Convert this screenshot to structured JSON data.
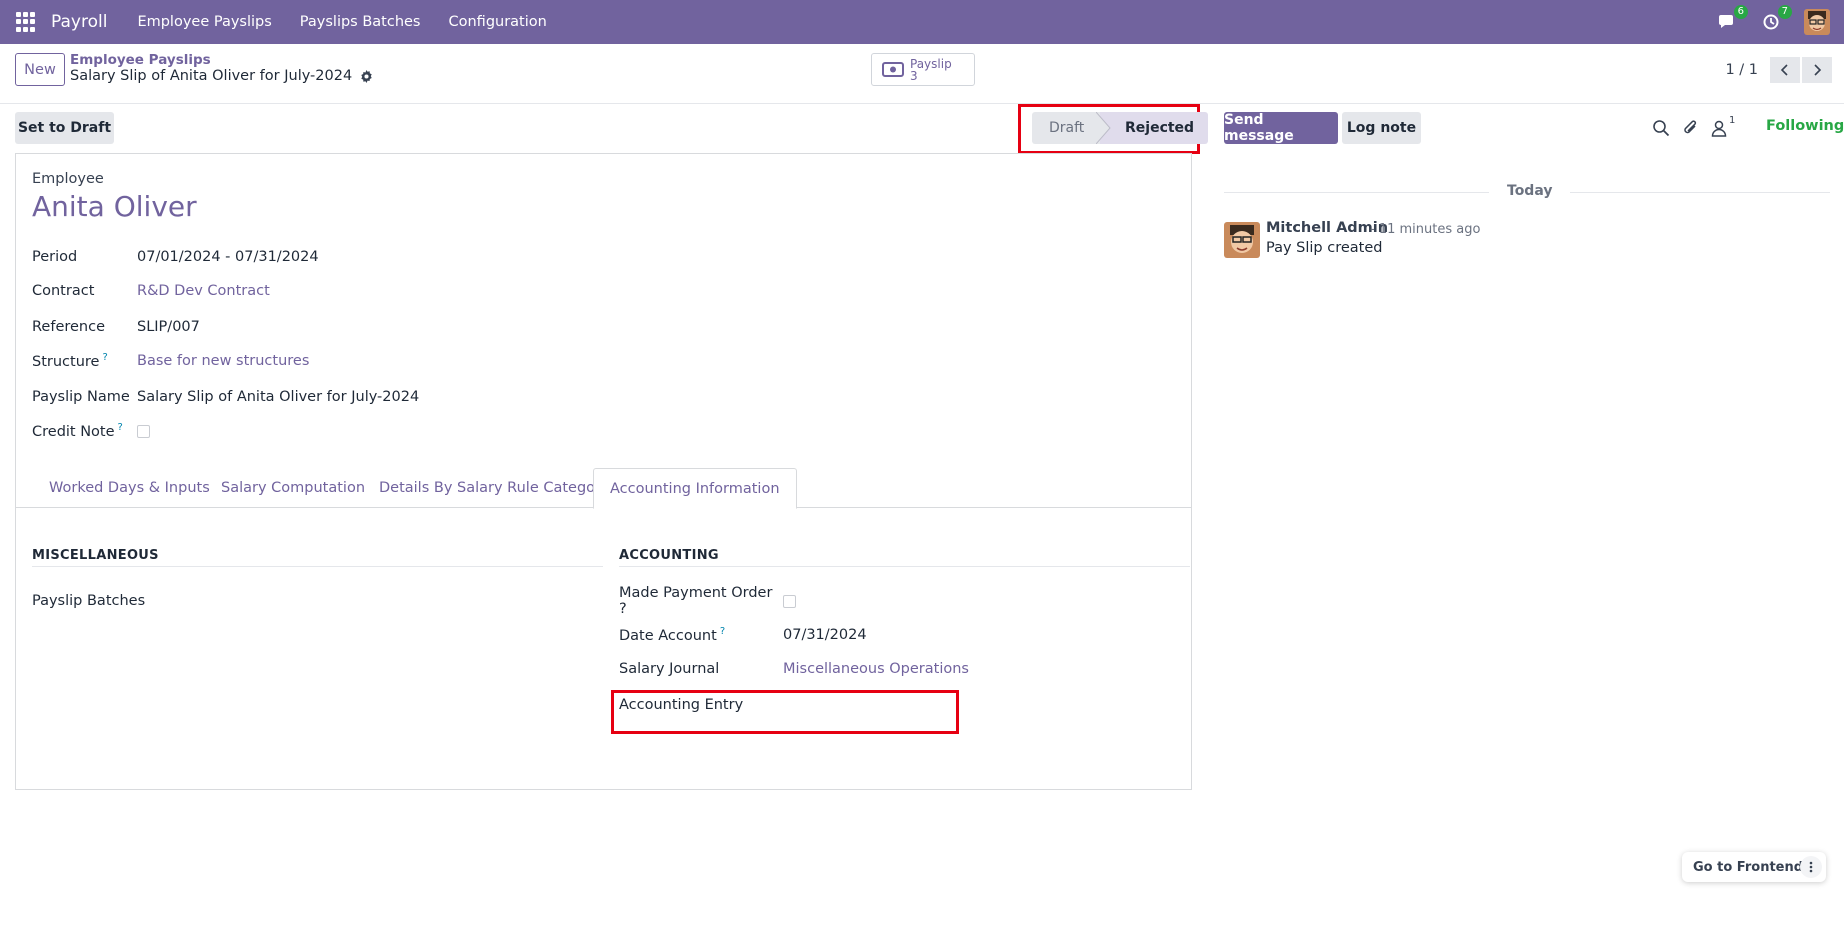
{
  "navbar": {
    "app_name": "Payroll",
    "menu": [
      "Employee Payslips",
      "Payslips Batches",
      "Configuration"
    ],
    "messages_count": "6",
    "activities_count": "7"
  },
  "control": {
    "new_label": "New",
    "breadcrumb_parent": "Employee Payslips",
    "breadcrumb_current": "Salary Slip of Anita Oliver for July-2024",
    "smart_button_label": "Payslip",
    "smart_button_count": "3",
    "pager": "1 / 1"
  },
  "statusbar": {
    "set_to_draft_label": "Set to Draft",
    "stages": [
      "Draft",
      "Rejected"
    ],
    "current_stage": "Rejected"
  },
  "form": {
    "employee_label": "Employee",
    "employee_name": "Anita Oliver",
    "fields": [
      {
        "label": "Period",
        "value": "07/01/2024 - 07/31/2024"
      },
      {
        "label": "Contract",
        "value": "R&D Dev Contract"
      },
      {
        "label": "Reference",
        "value": "SLIP/007"
      },
      {
        "label": "Structure",
        "value": "Base for new structures"
      },
      {
        "label": "Payslip Name",
        "value": "Salary Slip of Anita Oliver for July-2024"
      },
      {
        "label": "Credit Note",
        "value": ""
      }
    ],
    "help_mark": "?",
    "tabs": [
      "Worked Days & Inputs",
      "Salary Computation",
      "Details By Salary Rule Category",
      "Accounting Information"
    ],
    "active_tab": "Accounting Information",
    "misc_title": "MISCELLANEOUS",
    "misc_field": "Payslip Batches",
    "accounting_title": "ACCOUNTING",
    "accounting_fields": [
      {
        "label": "Made Payment Order ?",
        "value": ""
      },
      {
        "label": "Date Account",
        "value": "07/31/2024"
      },
      {
        "label": "Salary Journal",
        "value": "Miscellaneous Operations"
      },
      {
        "label": "Accounting Entry",
        "value": ""
      }
    ]
  },
  "chatter": {
    "send_message_label": "Send message",
    "log_note_label": "Log note",
    "follower_count": "1",
    "following_label": "Following",
    "date_separator": "Today",
    "message": {
      "author": "Mitchell Admin",
      "time": "- 11 minutes ago",
      "body": "Pay Slip created"
    }
  },
  "floating": {
    "go_to_frontend_label": "Go to Frontend"
  },
  "colors": {
    "brand": "#71639e",
    "highlight": "#e60012",
    "following": "#28a745"
  }
}
